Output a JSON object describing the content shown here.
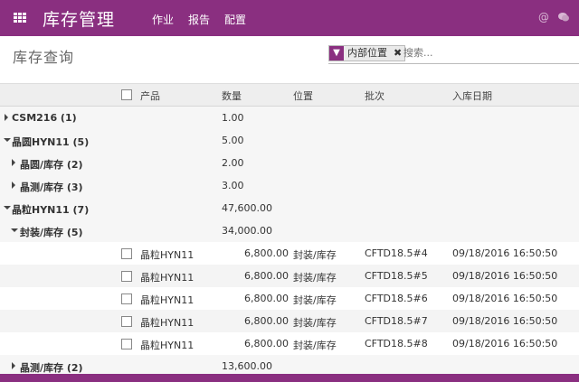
{
  "app": {
    "title": "库存管理",
    "menu": [
      "作业",
      "报告",
      "配置"
    ],
    "icons": [
      "at-icon",
      "chat-icon"
    ]
  },
  "control_panel": {
    "page_title": "库存查询",
    "filter_facet": "内部位置",
    "facet_remove": "✖",
    "search_placeholder": "搜索..."
  },
  "table": {
    "columns": [
      "产品",
      "数量",
      "位置",
      "批次",
      "入库日期"
    ],
    "groups": [
      {
        "label": "CSM216 (1)",
        "qty": "1.00",
        "expanded": false
      },
      {
        "label": "晶圆HYN11 (5)",
        "qty": "5.00",
        "expanded": true
      },
      {
        "label": "晶圆/库存 (2)",
        "qty": "2.00",
        "expanded": false
      },
      {
        "label": "晶测/库存 (3)",
        "qty": "3.00",
        "expanded": false
      },
      {
        "label": "晶粒HYN11 (7)",
        "qty": "47,600.00",
        "expanded": true
      },
      {
        "label": "封装/库存 (5)",
        "qty": "34,000.00",
        "expanded": true
      },
      {
        "label": "晶测/库存 (2)",
        "qty": "13,600.00",
        "expanded": false
      }
    ],
    "records": [
      {
        "product": "晶粒HYN11",
        "qty": "6,800.00",
        "location": "封装/库存",
        "lot": "CFTD18.5#4",
        "date": "09/18/2016 16:50:50"
      },
      {
        "product": "晶粒HYN11",
        "qty": "6,800.00",
        "location": "封装/库存",
        "lot": "CFTD18.5#5",
        "date": "09/18/2016 16:50:50"
      },
      {
        "product": "晶粒HYN11",
        "qty": "6,800.00",
        "location": "封装/库存",
        "lot": "CFTD18.5#6",
        "date": "09/18/2016 16:50:50"
      },
      {
        "product": "晶粒HYN11",
        "qty": "6,800.00",
        "location": "封装/库存",
        "lot": "CFTD18.5#7",
        "date": "09/18/2016 16:50:50"
      },
      {
        "product": "晶粒HYN11",
        "qty": "6,800.00",
        "location": "封装/库存",
        "lot": "CFTD18.5#8",
        "date": "09/18/2016 16:50:50"
      }
    ]
  },
  "colors": {
    "brand": "#8a2f80",
    "header_bg": "#eeeeee"
  }
}
